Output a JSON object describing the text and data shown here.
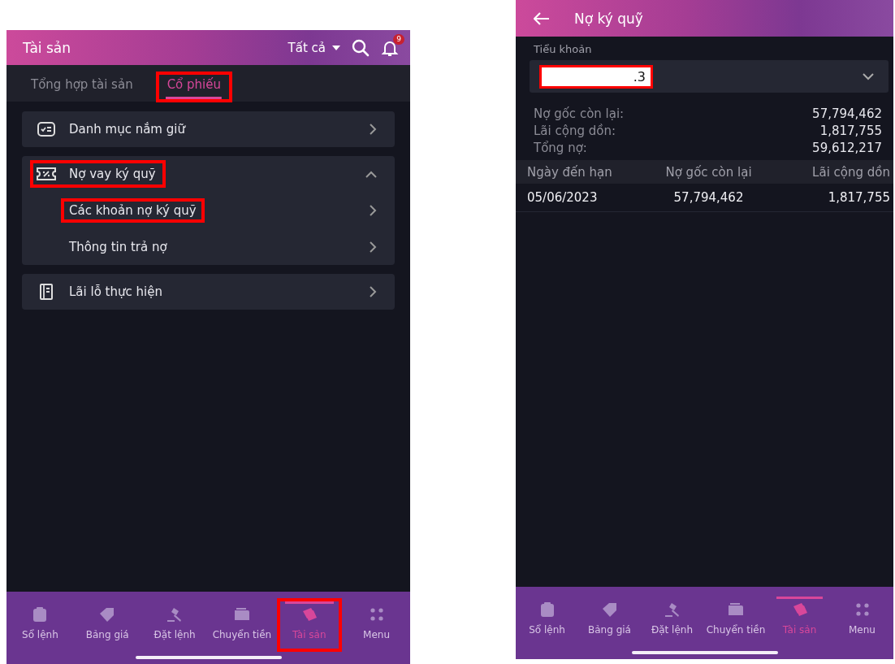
{
  "left_screen": {
    "header": {
      "title": "Tài sản",
      "filter": "Tất cả",
      "notification_count": "9"
    },
    "tabs": [
      {
        "label": "Tổng hợp tài sản",
        "selected": false,
        "highlighted": false
      },
      {
        "label": "Cổ phiếu",
        "selected": true,
        "highlighted": true
      }
    ],
    "menu_groups": [
      {
        "label": "Danh mục nắm giữ",
        "expanded": false,
        "highlighted": false
      },
      {
        "label": "Nợ vay ký quỹ",
        "expanded": true,
        "highlighted": true,
        "children": [
          {
            "label": "Các khoản nợ ký quỹ",
            "highlighted": true
          },
          {
            "label": "Thông tin trả nợ",
            "highlighted": false
          }
        ]
      },
      {
        "label": "Lãi lỗ thực hiện",
        "expanded": false,
        "highlighted": false
      }
    ],
    "bottom_nav": [
      {
        "label": "Sổ lệnh",
        "selected": false,
        "highlighted": false
      },
      {
        "label": "Bảng giá",
        "selected": false,
        "highlighted": false
      },
      {
        "label": "Đặt lệnh",
        "selected": false,
        "highlighted": false
      },
      {
        "label": "Chuyển tiền",
        "selected": false,
        "highlighted": false
      },
      {
        "label": "Tài sản",
        "selected": true,
        "highlighted": true
      },
      {
        "label": "Menu",
        "selected": false,
        "highlighted": false
      }
    ]
  },
  "right_screen": {
    "header": {
      "title": "Nợ ký quỹ"
    },
    "account": {
      "label": "Tiểu khoản",
      "value": ".3",
      "highlighted": true
    },
    "summary": [
      {
        "label": "Nợ gốc còn lại:",
        "value": "57,794,462"
      },
      {
        "label": "Lãi cộng dồn:",
        "value": "1,817,755"
      },
      {
        "label": "Tổng nợ:",
        "value": "59,612,217"
      }
    ],
    "table": {
      "columns": [
        "Ngày đến hạn",
        "Nợ gốc còn lại",
        "Lãi cộng dồn"
      ],
      "rows": [
        [
          "05/06/2023",
          "57,794,462",
          "1,817,755"
        ]
      ]
    },
    "bottom_nav": [
      {
        "label": "Sổ lệnh",
        "selected": false
      },
      {
        "label": "Bảng giá",
        "selected": false
      },
      {
        "label": "Đặt lệnh",
        "selected": false
      },
      {
        "label": "Chuyển tiền",
        "selected": false
      },
      {
        "label": "Tài sản",
        "selected": true
      },
      {
        "label": "Menu",
        "selected": false
      }
    ]
  }
}
